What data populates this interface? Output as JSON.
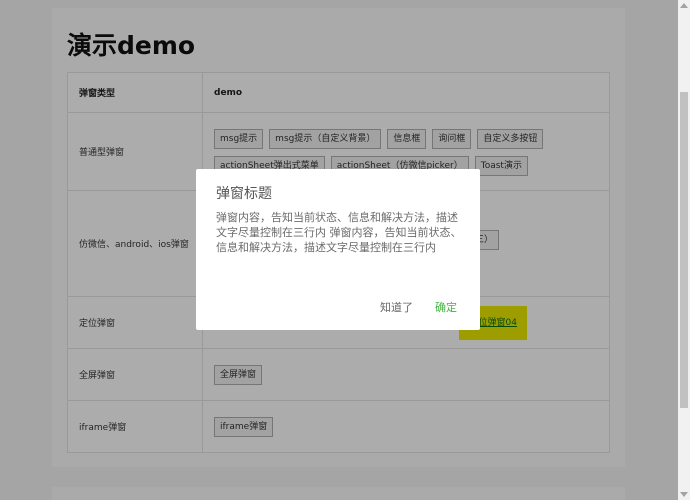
{
  "page": {
    "title": "演示demo"
  },
  "table": {
    "headers": [
      "弹窗类型",
      "demo"
    ],
    "rows": [
      {
        "label": "普通型弹窗",
        "buttons": [
          "msg提示",
          "msg提示（自定义背景）",
          "信息框",
          "询问框",
          "自定义多按钮",
          "actionSheet弹出式菜单",
          "actionSheet（仿微信picker）",
          "Toast演示"
        ]
      },
      {
        "label": "仿微信、android、ios弹窗",
        "buttons": [
          "三）"
        ]
      },
      {
        "label": "定位弹窗",
        "buttons": [
          "位弹窗04"
        ]
      },
      {
        "label": "全屏弹窗",
        "buttons": [
          "全屏弹窗"
        ]
      },
      {
        "label": "iframe弹窗",
        "buttons": [
          "iframe弹窗"
        ]
      }
    ]
  },
  "dialog": {
    "title": "弹窗标题",
    "body": "弹窗内容，告知当前状态、信息和解决方法，描述文字尽量控制在三行内 弹窗内容，告知当前状态、信息和解决方法，描述文字尽量控制在三行内",
    "cancel_label": "知道了",
    "ok_label": "确定"
  },
  "colors": {
    "accent_green": "#3fb53f",
    "highlight_yellow": "#e1e100"
  }
}
